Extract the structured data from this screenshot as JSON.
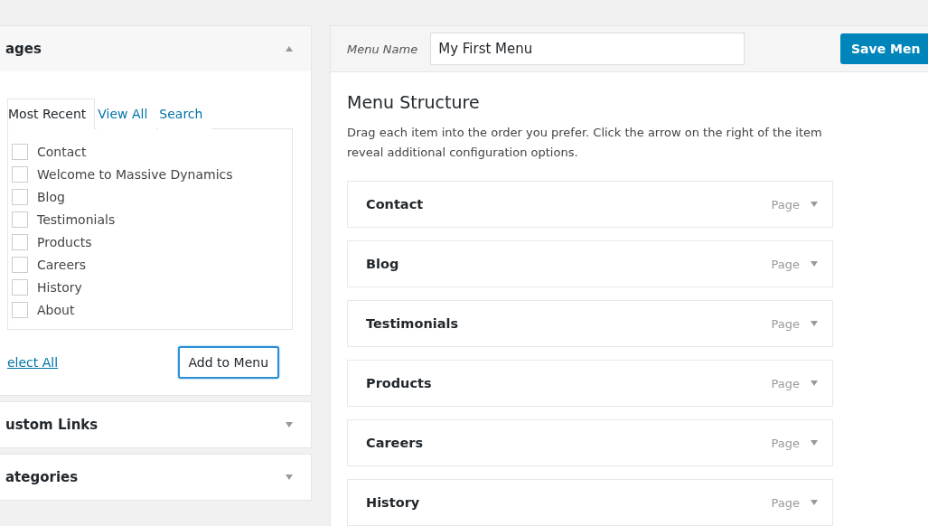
{
  "sidebar": {
    "sections": [
      {
        "title": "ages",
        "expanded": true,
        "tabs": [
          {
            "label": "Most Recent",
            "selected": true
          },
          {
            "label": "View All",
            "selected": false
          },
          {
            "label": "Search",
            "selected": false
          }
        ],
        "items": [
          {
            "label": "Contact",
            "checked": false
          },
          {
            "label": "Welcome to Massive Dynamics",
            "checked": false
          },
          {
            "label": "Blog",
            "checked": false
          },
          {
            "label": "Testimonials",
            "checked": false
          },
          {
            "label": "Products",
            "checked": false
          },
          {
            "label": "Careers",
            "checked": false
          },
          {
            "label": "History",
            "checked": false
          },
          {
            "label": "About",
            "checked": false
          }
        ],
        "select_all": "elect All",
        "add_button": "Add to Menu"
      },
      {
        "title": "ustom Links",
        "expanded": false
      },
      {
        "title": "ategories",
        "expanded": false
      }
    ]
  },
  "menu": {
    "name_label": "Menu Name",
    "name_value": "My First Menu",
    "save_button": "Save Men",
    "title": "Menu Structure",
    "description": [
      "Drag each item into the order you prefer. Click the arrow on the right of the item",
      "reveal additional configuration options."
    ],
    "items": [
      {
        "label": "Contact",
        "type": "Page"
      },
      {
        "label": "Blog",
        "type": "Page"
      },
      {
        "label": "Testimonials",
        "type": "Page"
      },
      {
        "label": "Products",
        "type": "Page"
      },
      {
        "label": "Careers",
        "type": "Page"
      },
      {
        "label": "History",
        "type": "Page"
      }
    ]
  }
}
